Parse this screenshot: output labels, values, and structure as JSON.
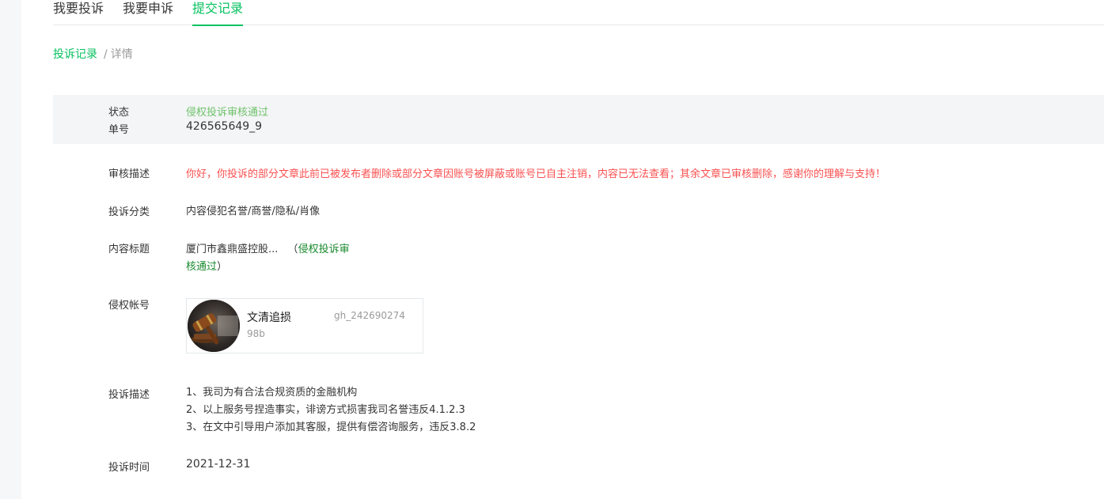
{
  "tabs": [
    {
      "label": "我要投诉"
    },
    {
      "label": "我要申诉"
    },
    {
      "label": "提交记录"
    }
  ],
  "breadcrumb": {
    "link": "投诉记录",
    "separator": "/",
    "current": "详情"
  },
  "status": {
    "label": "状态",
    "value": "侵权投诉审核通过",
    "order_label": "单号",
    "order_value": "426565649_9"
  },
  "review": {
    "label": "审核描述",
    "value": "你好，你投诉的部分文章此前已被发布者删除或部分文章因账号被屏蔽或账号已自主注销，内容已无法查看；其余文章已审核删除，感谢你的理解与支持！"
  },
  "category": {
    "label": "投诉分类",
    "value": "内容侵犯名誉/商誉/隐私/肖像"
  },
  "content_title": {
    "label": "内容标题",
    "title": "厦门市鑫鼎盛控股...",
    "open_paren": "（",
    "status_part1": "侵权投诉审",
    "status_part2": "核通过",
    "close_paren": "）"
  },
  "account": {
    "label": "侵权帐号",
    "name": "文清追损",
    "id": "gh_242690274",
    "sub": "98b"
  },
  "description": {
    "label": "投诉描述",
    "lines": [
      "1、我司为有合法合规资质的金融机构",
      "2、以上服务号捏造事实，诽谤方式损害我司名誉违反4.1.2.3",
      "3、在文中引导用户添加其客服，提供有偿咨询服务，违反3.8.2"
    ]
  },
  "time": {
    "label": "投诉时间",
    "value": "2021-12-31"
  },
  "colors": {
    "brand_green": "#07c160",
    "status_green": "#6fc26a",
    "warning_red": "#fa5151"
  }
}
